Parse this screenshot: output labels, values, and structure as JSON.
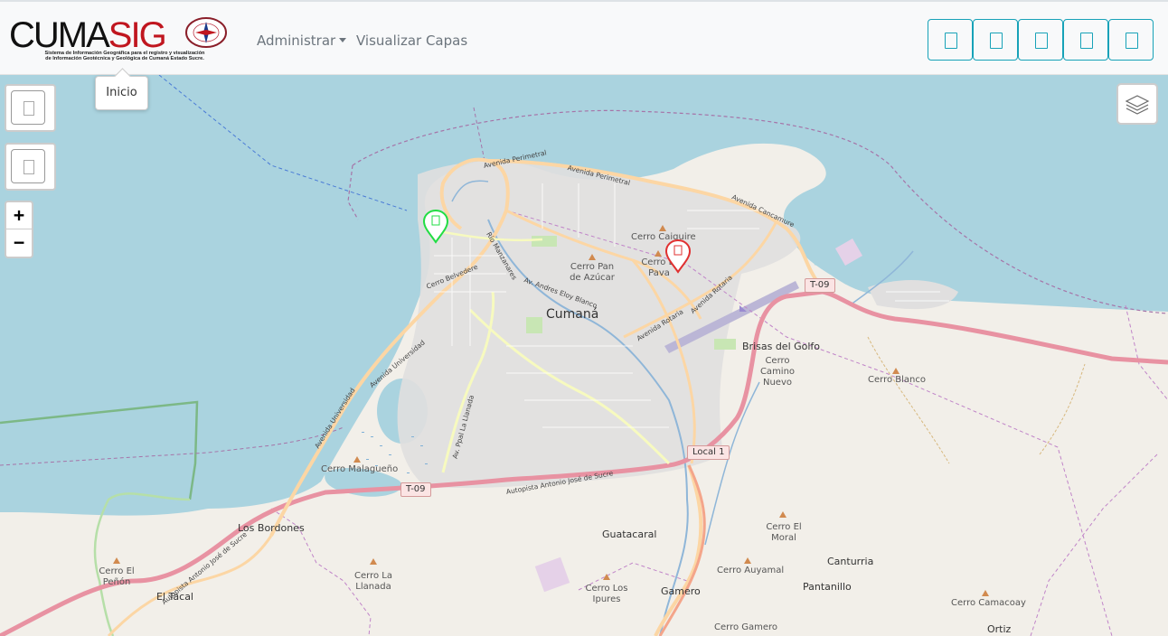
{
  "brand": {
    "title_part1": "CUMA",
    "title_part2": "SIG",
    "subtitle_line1": "Sistema de Información Geográfica para el registro y visualización",
    "subtitle_line2": "de Información Geotécnica y Geológica de Cumaná Estado Sucre."
  },
  "nav": {
    "admin_label": "Administrar",
    "layers_label": "Visualizar Capas"
  },
  "toolbar": {
    "buttons": [
      "tool-1",
      "tool-2",
      "tool-3",
      "tool-4",
      "tool-5"
    ]
  },
  "tooltip": {
    "text": "Inicio"
  },
  "map_controls": {
    "zoom_in": "+",
    "zoom_out": "−",
    "layers_icon": "layers-icon"
  },
  "markers": [
    {
      "name": "green-marker",
      "color": "#22dd44"
    },
    {
      "name": "red-marker",
      "color": "#e03030"
    }
  ],
  "map": {
    "city": "Cumaná",
    "places": [
      "Brisas del Golfo",
      "Los Bordones",
      "El Tacal",
      "Guatacaral",
      "Gamero",
      "Canturria",
      "Pantanillo",
      "Ortiz"
    ],
    "peaks": [
      "Cerro Caiguire",
      "Cerro El Pava",
      "Cerro Pan de Azúcar",
      "Cerro Camino Nuevo",
      "Cerro Blanco",
      "Cerro Malagueño",
      "Cerro El Peñón",
      "Cerro La Llanada",
      "Cerro Los Ipures",
      "Cerro El Moral",
      "Cerro Auyamal",
      "Cerro Camacoay",
      "Cerro Gamero"
    ],
    "roads": [
      "Avenida Perimetral",
      "Avenida Perimetral",
      "Avenida Cancamure",
      "Av. Andres Eloy Blanco",
      "Avenida Rotaria",
      "Avenida Rotaria",
      "Avenida Universidad",
      "Avenida Universidad",
      "Av. Ppal La Llanada",
      "Autopista Antonio José de Sucre",
      "Autopista Antonio José de Sucre",
      "Cerro Belvedere",
      "Río Manzanares"
    ],
    "shields": [
      "T-09",
      "T-09",
      "Local 1"
    ]
  }
}
